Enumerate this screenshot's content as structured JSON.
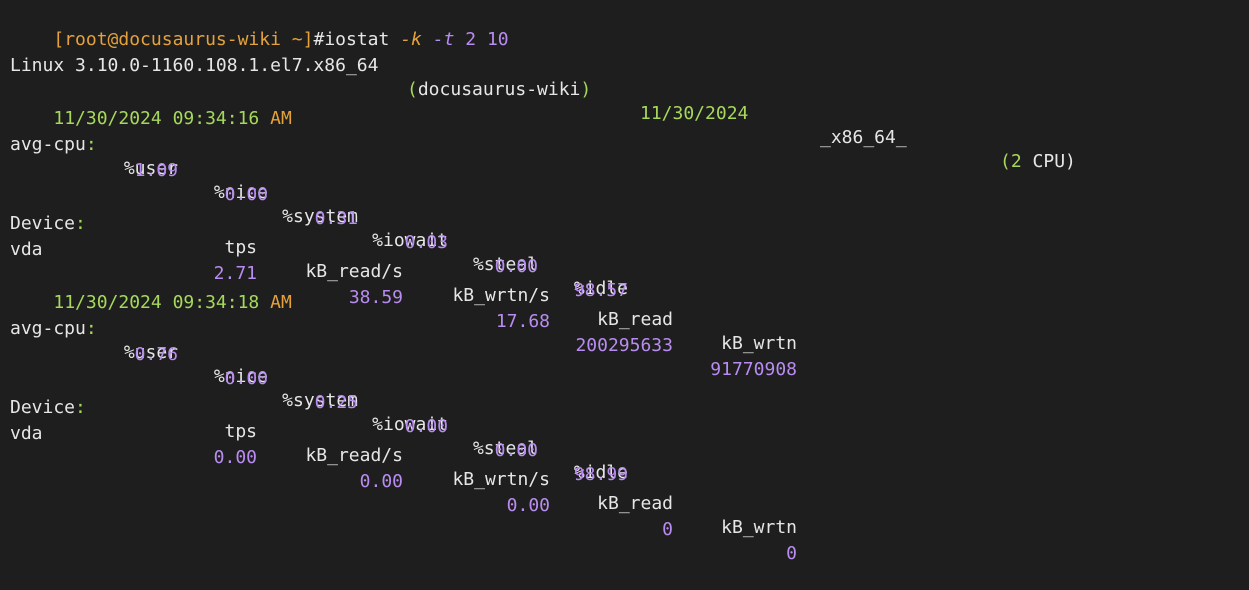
{
  "prompt": {
    "bracket_open": "[",
    "user_host": "root@docusaurus-wiki",
    "cwd": " ~",
    "bracket_close": "]",
    "hash": "#",
    "command": "iostat",
    "flag_k": "-k",
    "flag_t": "-t",
    "arg_interval": "2",
    "arg_count": "10"
  },
  "sysinfo": {
    "kernel": "Linux 3.10.0-1160.108.1.el7.x86_64",
    "paren_open": "(",
    "hostname": "docusaurus-wiki",
    "paren_close": ")",
    "date": "11/30/2024",
    "arch": "_x86_64_",
    "cpu_paren_open": "(",
    "cpu_count": "2",
    "cpu_label": " CPU)"
  },
  "reports": [
    {
      "timestamp": "11/30/2024 09:34:16",
      "ampm": "AM",
      "cpu_label": "avg-cpu",
      "cpu_colon": ":",
      "cpu_headers": [
        "%user",
        "%nice",
        "%system",
        "%iowait",
        "%steal",
        "%idle"
      ],
      "cpu_values": [
        "1.09",
        "0.00",
        "0.31",
        "0.03",
        "0.00",
        "98.57"
      ],
      "device_label": "Device",
      "device_colon": ":",
      "device_headers": [
        "tps",
        "kB_read/s",
        "kB_wrtn/s",
        "kB_read",
        "kB_wrtn"
      ],
      "device_name": "vda",
      "device_values": [
        "2.71",
        "38.59",
        "17.68",
        "200295633",
        "91770908"
      ]
    },
    {
      "timestamp": "11/30/2024 09:34:18",
      "ampm": "AM",
      "cpu_label": "avg-cpu",
      "cpu_colon": ":",
      "cpu_headers": [
        "%user",
        "%nice",
        "%system",
        "%iowait",
        "%steal",
        "%idle"
      ],
      "cpu_values": [
        "0.76",
        "0.00",
        "0.25",
        "0.00",
        "0.00",
        "98.99"
      ],
      "device_label": "Device",
      "device_colon": ":",
      "device_headers": [
        "tps",
        "kB_read/s",
        "kB_wrtn/s",
        "kB_read",
        "kB_wrtn"
      ],
      "device_name": "vda",
      "device_values": [
        "0.00",
        "0.00",
        "0.00",
        "0",
        "0"
      ]
    }
  ],
  "colors": {
    "background": "#1e1e1e",
    "text": "#e6e6e6",
    "prompt": "#e5a13b",
    "green": "#a6d95b",
    "purple": "#b88cf0"
  }
}
